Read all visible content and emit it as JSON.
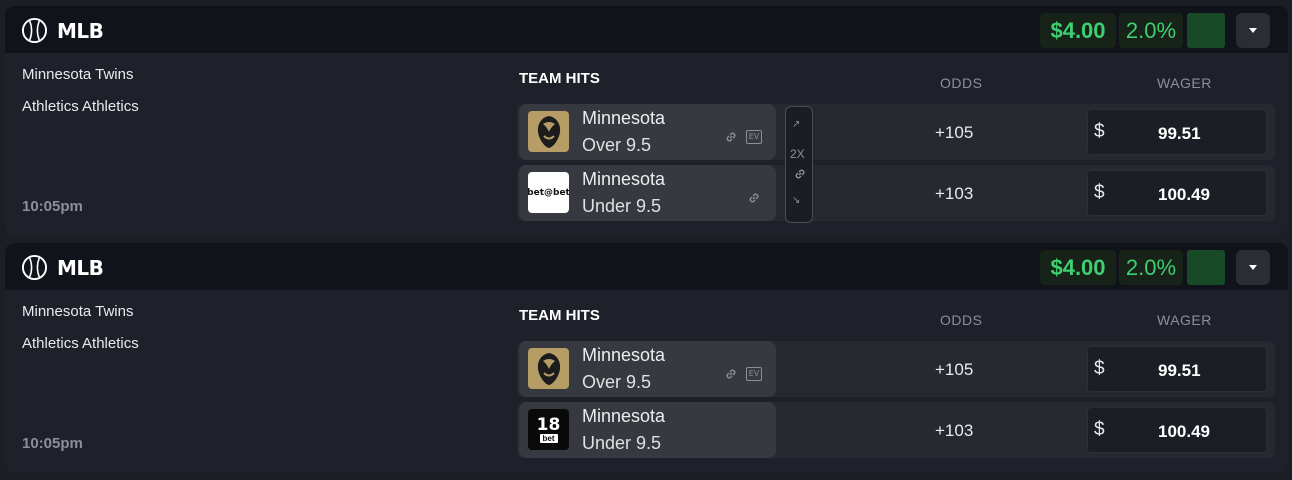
{
  "colors": {
    "accent_green": "#3ecf70",
    "page_bg": "#1b1e25",
    "card_header_bg": "#10131a"
  },
  "cards": [
    {
      "league": "MLB",
      "profit": "$4.00",
      "percent": "2.0%",
      "teams": [
        "Minnesota Twins",
        "Athletics Athletics"
      ],
      "time": "10:05pm",
      "market": "TEAM HITS",
      "odds_header": "ODDS",
      "wager_header": "WAGER",
      "multiplier": "2X",
      "rows": [
        {
          "book": "BetMGM",
          "book_icon": "lion-logo-icon",
          "team": "Minnesota",
          "line": "Over 9.5",
          "odds": "+105",
          "currency": "$",
          "wager": "99.51",
          "has_ev": true
        },
        {
          "book": "bet@bet",
          "book_icon": "betatbet-logo-icon",
          "team": "Minnesota",
          "line": "Under 9.5",
          "odds": "+103",
          "currency": "$",
          "wager": "100.49",
          "has_ev": false
        }
      ]
    },
    {
      "league": "MLB",
      "profit": "$4.00",
      "percent": "2.0%",
      "teams": [
        "Minnesota Twins",
        "Athletics Athletics"
      ],
      "time": "10:05pm",
      "market": "TEAM HITS",
      "odds_header": "ODDS",
      "wager_header": "WAGER",
      "rows": [
        {
          "book": "BetMGM",
          "book_icon": "lion-logo-icon",
          "team": "Minnesota",
          "line": "Over 9.5",
          "odds": "+105",
          "currency": "$",
          "wager": "99.51",
          "has_ev": true
        },
        {
          "book": "18bet",
          "book_icon": "18bet-logo-icon",
          "team": "Minnesota",
          "line": "Under 9.5",
          "odds": "+103",
          "currency": "$",
          "wager": "100.49",
          "has_ev": false
        }
      ]
    }
  ],
  "logo_text": {
    "betbet": "bet@bet",
    "eighteen": "18",
    "bet": "bet",
    "ev": "EV"
  }
}
